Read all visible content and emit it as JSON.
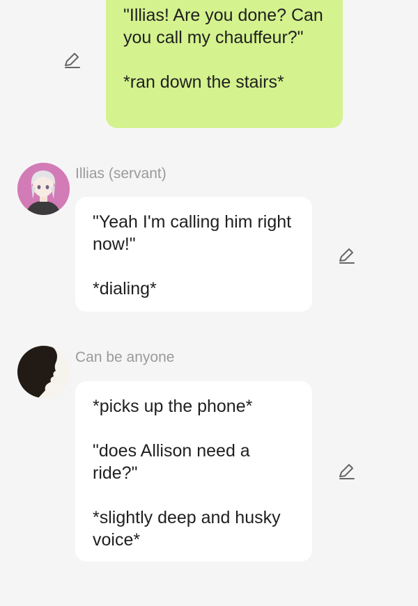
{
  "messages": [
    {
      "sender": "user",
      "text": "\"Illias! Are you done? Can you call my chauffeur?\"\n\n*ran down the stairs*"
    },
    {
      "sender_name": "Illias (servant)",
      "text": "\"Yeah I'm calling him right now!\"\n\n*dialing*"
    },
    {
      "sender_name": "Can be anyone",
      "text": "*picks up the phone*\n\n\"does Allison need a ride?\"\n\n*slightly deep and husky voice*"
    }
  ],
  "colors": {
    "background": "#f5f5f5",
    "user_bubble": "#d4f28e",
    "other_bubble": "#ffffff",
    "name_text": "#9a9a9a"
  },
  "icons": [
    "pencil-edit-icon"
  ]
}
